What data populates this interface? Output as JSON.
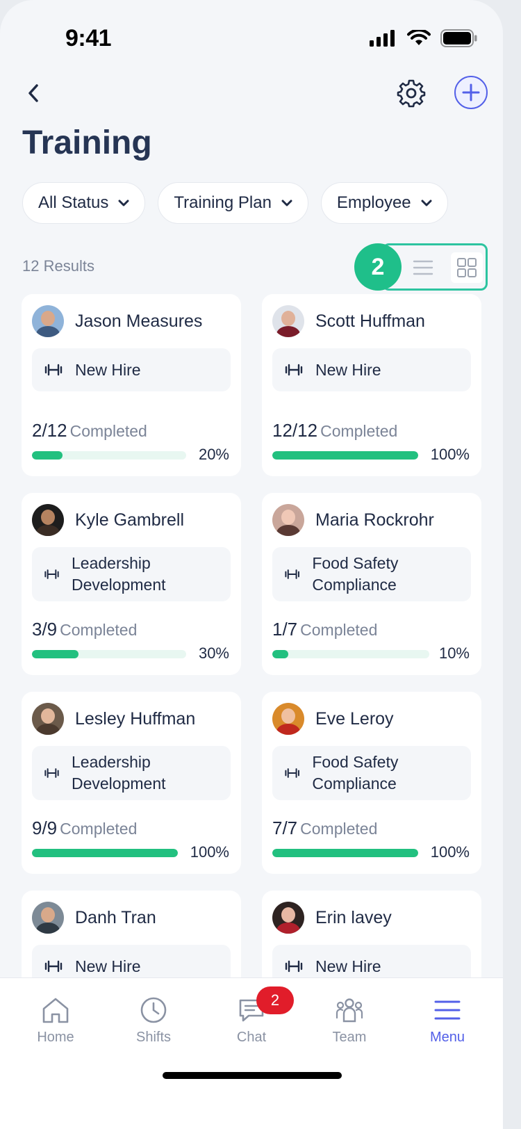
{
  "status_bar": {
    "time": "9:41"
  },
  "header": {
    "title": "Training"
  },
  "filters": [
    {
      "label": "All Status"
    },
    {
      "label": "Training Plan"
    },
    {
      "label": "Employee"
    }
  ],
  "results": {
    "count_label": "12 Results",
    "step_badge": "2"
  },
  "colors": {
    "accent": "#5360e8",
    "progress": "#22c07f",
    "highlight": "#2dc4a0",
    "badge": "#e11d2a"
  },
  "cards": [
    {
      "name": "Jason Measures",
      "plan": "New Hire",
      "progress": "2/12",
      "completed_label": "Completed",
      "percent": "20%",
      "fraction": 0.2
    },
    {
      "name": "Scott Huffman",
      "plan": "New Hire",
      "progress": "12/12",
      "completed_label": "Completed",
      "percent": "100%",
      "fraction": 1.0
    },
    {
      "name": "Kyle Gambrell",
      "plan": "Leadership Development",
      "progress": "3/9",
      "completed_label": "Completed",
      "percent": "30%",
      "fraction": 0.3
    },
    {
      "name": "Maria Rockrohr",
      "plan": "Food Safety Compliance",
      "progress": "1/7",
      "completed_label": "Completed",
      "percent": "10%",
      "fraction": 0.1
    },
    {
      "name": "Lesley Huffman",
      "plan": "Leadership Development",
      "progress": "9/9",
      "completed_label": "Completed",
      "percent": "100%",
      "fraction": 1.0
    },
    {
      "name": "Eve Leroy",
      "plan": "Food Safety Compliance",
      "progress": "7/7",
      "completed_label": "Completed",
      "percent": "100%",
      "fraction": 1.0
    },
    {
      "name": "Danh Tran",
      "plan": "New Hire"
    },
    {
      "name": "Erin lavey",
      "plan": "New Hire"
    }
  ],
  "tabs": [
    {
      "label": "Home",
      "icon": "home-icon"
    },
    {
      "label": "Shifts",
      "icon": "clock-icon"
    },
    {
      "label": "Chat",
      "icon": "chat-icon",
      "badge": "2"
    },
    {
      "label": "Team",
      "icon": "team-icon"
    },
    {
      "label": "Menu",
      "icon": "menu-icon",
      "active": true
    }
  ]
}
